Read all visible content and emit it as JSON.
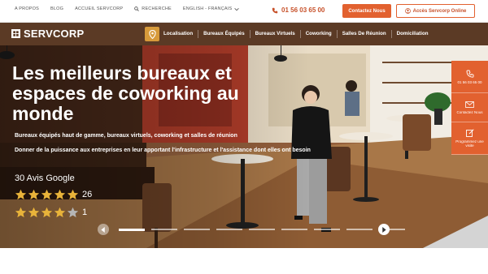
{
  "topbar": {
    "links": [
      "A PROPOS",
      "BLOG",
      "ACCUEIL SERVCORP",
      "RECHERCHE",
      "ENGLISH - FRANÇAIS"
    ],
    "phone": "01 56 03 65 00",
    "contact_label": "Contactez Nous",
    "access_label": "Accès Servcorp Online"
  },
  "brand": {
    "name": "SERVCORP"
  },
  "nav": {
    "items": [
      "Localisation",
      "Bureaux Équipés",
      "Bureaux Virtuels",
      "Coworking",
      "Salles De Réunion",
      "Domiciliation"
    ]
  },
  "hero": {
    "title": "Les meilleurs bureaux et espaces de coworking au monde",
    "subtitle": "Bureaux équipés haut de gamme, bureaux virtuels, coworking et salles de réunion",
    "description": "Donner de la puissance aux entreprises en leur apportant l'infrastructure et l'assistance dont elles ont besoin",
    "reviews_title": "30 Avis Google",
    "ratings": [
      {
        "stars": 5,
        "count": "26"
      },
      {
        "stars": 4,
        "count": "1"
      }
    ],
    "slide_count": 9,
    "active_slide": 0
  },
  "siderail": {
    "phone": "01 56 03 65 00",
    "contact": "Contactez Nous",
    "visit": "Programmez une visite"
  },
  "colors": {
    "accent": "#e2612f",
    "nav_bg": "#5b3a25",
    "gold": "#d79a3a"
  }
}
